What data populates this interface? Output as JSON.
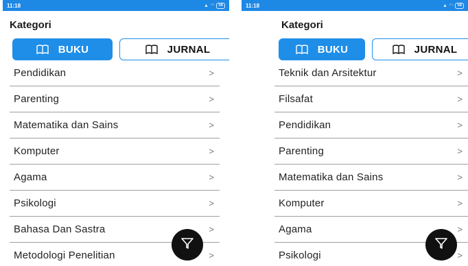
{
  "screens": [
    {
      "status_time": "11:18",
      "battery": "58",
      "title": "Kategori",
      "tab_buku": "BUKU",
      "tab_jurnal": "JURNAL",
      "items": [
        "Pendidikan",
        "Parenting",
        "Matematika dan Sains",
        "Komputer",
        "Agama",
        "Psikologi",
        "Bahasa Dan Sastra",
        "Metodologi Penelitian"
      ]
    },
    {
      "status_time": "11:18",
      "battery": "58",
      "title": "Kategori",
      "tab_buku": "BUKU",
      "tab_jurnal": "JURNAL",
      "items": [
        "Teknik dan Arsitektur",
        "Filsafat",
        "Pendidikan",
        "Parenting",
        "Matematika dan Sains",
        "Komputer",
        "Agama",
        "Psikologi"
      ]
    }
  ],
  "chevron": ">",
  "icons": {
    "tab_icon": "book-open-icon",
    "fab_icon": "filter-icon",
    "row_icon": "chevron-right-icon"
  },
  "colors": {
    "accent": "#1e8ee8",
    "statusbar": "#1e88e5",
    "fab": "#111111"
  }
}
